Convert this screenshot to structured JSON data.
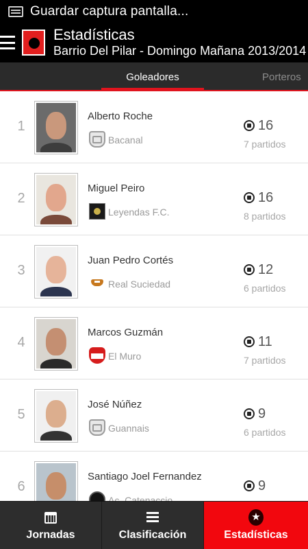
{
  "status_bar": {
    "text": "Guardar captura pantalla..."
  },
  "action_bar": {
    "title": "Estadísticas",
    "subtitle": "Barrio Del Pilar - Domingo Mañana 2013/2014"
  },
  "tabs": [
    {
      "label": "Goleadores",
      "selected": true
    },
    {
      "label": "Porteros",
      "selected": false
    }
  ],
  "players": [
    {
      "rank": "1",
      "name": "Alberto Roche",
      "team": "Bacanal",
      "goals": "16",
      "matches": "7 partidos",
      "badge": "shield-badge-icon",
      "skin": "#c9987c",
      "shirt": "#3d3d3d"
    },
    {
      "rank": "2",
      "name": "Miguel Peiro",
      "team": "Leyendas F.C.",
      "goals": "16",
      "matches": "8 partidos",
      "badge": "dark-crest-icon",
      "skin": "#e2a78d",
      "shirt": "#7a4a3a"
    },
    {
      "rank": "3",
      "name": "Juan Pedro Cortés",
      "team": "Real Suciedad",
      "goals": "12",
      "matches": "6 partidos",
      "badge": "orange-crest-icon",
      "skin": "#e6b49a",
      "shirt": "#2c3550"
    },
    {
      "rank": "4",
      "name": "Marcos Guzmán",
      "team": "El Muro",
      "goals": "11",
      "matches": "7 partidos",
      "badge": "red-crest-icon",
      "skin": "#c48f72",
      "shirt": "#2a2a2a"
    },
    {
      "rank": "5",
      "name": "José Núñez",
      "team": "Guannais",
      "goals": "9",
      "matches": "6 partidos",
      "badge": "shield-badge-icon",
      "skin": "#dcae8e",
      "shirt": "#333333"
    },
    {
      "rank": "6",
      "name": "Santiago Joel Fernandez",
      "team": "Ac. Catenaccio",
      "goals": "9",
      "matches": "",
      "badge": "round-crest-icon",
      "skin": "#c68e6a",
      "shirt": "#444444"
    }
  ],
  "bottom_nav": [
    {
      "label": "Jornadas",
      "icon": "calendar-icon",
      "active": false
    },
    {
      "label": "Clasificación",
      "icon": "list-icon",
      "active": false
    },
    {
      "label": "Estadísticas",
      "icon": "star-icon",
      "active": true
    }
  ],
  "colors": {
    "accent": "#e0141e",
    "active_nav": "#f2070e",
    "bar": "#000000",
    "tabs_bg": "#2b2b2b"
  }
}
